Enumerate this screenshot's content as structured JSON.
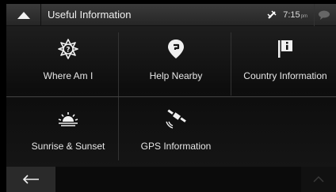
{
  "header": {
    "title": "Useful Information",
    "time": "7:15",
    "ampm": "pm",
    "icons": {
      "back": "chevron-up-icon",
      "gps": "satellite-icon",
      "messages": "message-bubble-icon"
    }
  },
  "tiles": [
    {
      "label": "Where Am I",
      "icon": "compass-question-icon"
    },
    {
      "label": "Help Nearby",
      "icon": "help-pin-icon"
    },
    {
      "label": "Country Information",
      "icon": "info-flag-icon"
    },
    {
      "label": "Sunrise & Sunset",
      "icon": "sunrise-icon"
    },
    {
      "label": "GPS Information",
      "icon": "satellite-icon"
    }
  ],
  "footer": {
    "back_icon": "arrow-left-icon",
    "scroll_up_icon": "chevron-up-icon"
  }
}
